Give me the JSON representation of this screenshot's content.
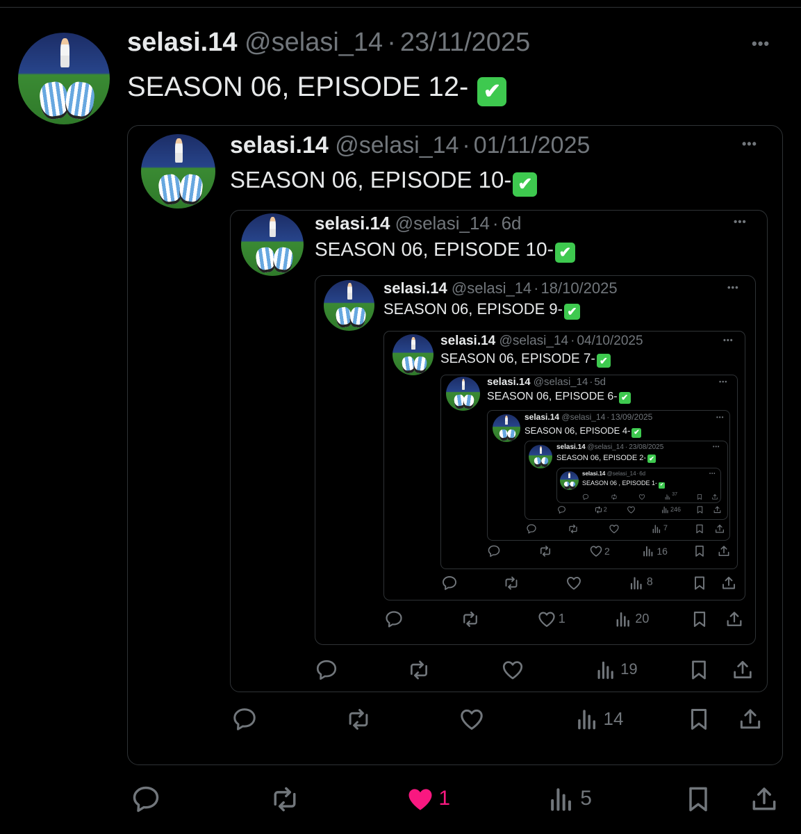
{
  "tweets": [
    {
      "name": "selasi.14",
      "handle": "@selasi_14",
      "sep": "·",
      "date": "23/11/2025",
      "text": "SEASON 06, EPISODE 12- ",
      "check": "✔",
      "more": "•••",
      "replies": "",
      "reposts": "",
      "likes": "1",
      "views": "5"
    },
    {
      "name": "selasi.14",
      "handle": "@selasi_14",
      "sep": "·",
      "date": "01/11/2025",
      "text": "SEASON 06, EPISODE 10-",
      "check": "✔",
      "more": "•••",
      "replies": "",
      "reposts": "",
      "likes": "",
      "views": "14"
    },
    {
      "name": "selasi.14",
      "handle": "@selasi_14",
      "sep": "·",
      "date": "6d",
      "text": "SEASON 06, EPISODE 10-",
      "check": "✔",
      "more": "•••",
      "replies": "",
      "reposts": "",
      "likes": "",
      "views": "19"
    },
    {
      "name": "selasi.14",
      "handle": "@selasi_14",
      "sep": "·",
      "date": "18/10/2025",
      "text": "SEASON 06, EPISODE 9-",
      "check": "✔",
      "more": "•••",
      "replies": "",
      "reposts": "",
      "likes": "1",
      "views": "20"
    },
    {
      "name": "selasi.14",
      "handle": "@selasi_14",
      "sep": "·",
      "date": "04/10/2025",
      "text": "SEASON 06, EPISODE 7-",
      "check": "✔",
      "more": "•••",
      "replies": "",
      "reposts": "",
      "likes": "",
      "views": "8"
    },
    {
      "name": "selasi.14",
      "handle": "@selasi_14",
      "sep": "·",
      "date": "5d",
      "text": "SEASON 06, EPISODE 6-",
      "check": "✔",
      "more": "•••",
      "replies": "",
      "reposts": "",
      "likes": "2",
      "views": "16"
    },
    {
      "name": "selasi.14",
      "handle": "@selasi_14",
      "sep": "·",
      "date": "13/09/2025",
      "text": "SEASON 06, EPISODE 4-",
      "check": "✔",
      "more": "•••",
      "replies": "",
      "reposts": "",
      "likes": "",
      "views": "7"
    },
    {
      "name": "selasi.14",
      "handle": "@selasi_14",
      "sep": "·",
      "date": "23/08/2025",
      "text": "SEASON 06, EPISODE 2-",
      "check": "✔",
      "more": "•••",
      "replies": "",
      "reposts": "2",
      "likes": "",
      "views": "246"
    },
    {
      "name": "selasi.14",
      "handle": "@selasi_14",
      "sep": "·",
      "date": "6d",
      "text": "SEASON 06 , EPISODE 1-",
      "check": "✔",
      "more": "•••",
      "replies": "",
      "reposts": "",
      "likes": "",
      "views": "37"
    }
  ],
  "colors": {
    "like_active": "#f91880",
    "muted": "#71767b",
    "text": "#e7e9ea",
    "check": "#3ec94f",
    "border": "#2f3336"
  },
  "icons": [
    "reply-icon",
    "repost-icon",
    "like-icon",
    "views-icon",
    "bookmark-icon",
    "share-icon"
  ]
}
